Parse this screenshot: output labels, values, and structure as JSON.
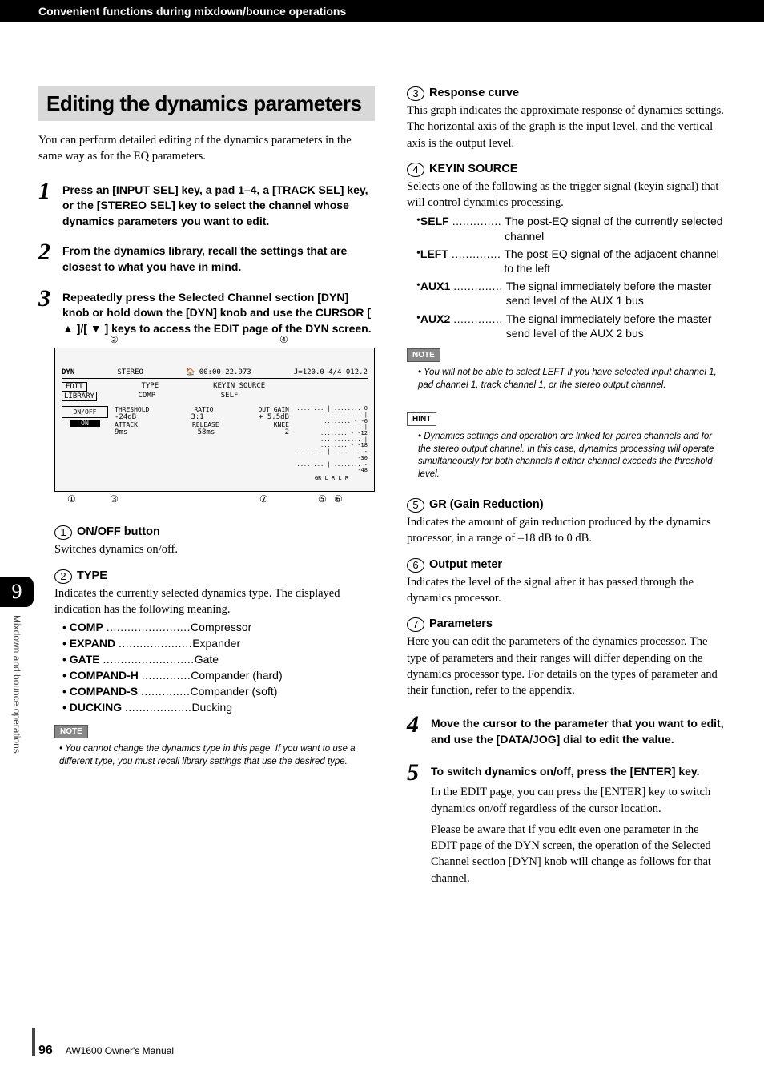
{
  "header": "Convenient functions during mixdown/bounce operations",
  "title": "Editing the dynamics parameters",
  "intro": "You can perform detailed editing of the dynamics parameters in the same way as for the EQ parameters.",
  "steps_left": [
    "Press an [INPUT SEL] key, a pad 1–4, a [TRACK SEL] key, or the [STEREO SEL] key to select the channel whose dynamics parameters you want to edit.",
    "From the dynamics library, recall the settings that are closest to what you have in mind.",
    "Repeatedly press the Selected Channel section [DYN] knob or hold down the [DYN] knob and use the CURSOR [ ▲ ]/[ ▼ ] keys to access the EDIT page of the DYN screen."
  ],
  "screen": {
    "title_bar_left": "DYN",
    "title_bar_mid": "STEREO",
    "title_bar_time": "00:00:22.973",
    "title_bar_right": "J=120.0 4/4 012.2",
    "tabs_left": "EDIT",
    "tabs_left2": "LIBRARY",
    "type_label": "TYPE",
    "type_value": "COMP",
    "keyin_source_label": "KEYIN SOURCE",
    "keyin_source_value": "SELF",
    "onoff": "ON/OFF",
    "on_val": "ON",
    "threshold": "THRESHOLD",
    "threshold_val": "-24dB",
    "ratio": "RATIO",
    "ratio_val": "3:1",
    "outgain": "OUT GAIN",
    "outgain_val": "+ 5.5dB",
    "attack": "ATTACK",
    "attack_val": "9ms",
    "release": "RELEASE",
    "release_val": "58ms",
    "knee": "KNEE",
    "knee_val": "2",
    "meters_label": "GR L R   L R",
    "scale": [
      "0",
      "-6",
      "-12",
      "-18",
      "-30",
      "-48"
    ]
  },
  "item1_label": "ON/OFF button",
  "item1_desc": "Switches dynamics on/off.",
  "item2_label": "TYPE",
  "item2_desc": "Indicates the currently selected dynamics type. The displayed indication has the following meaning.",
  "type_list": [
    {
      "label": "COMP",
      "dots": "........................",
      "desc": "Compressor"
    },
    {
      "label": "EXPAND",
      "dots": ".....................",
      "desc": "Expander"
    },
    {
      "label": "GATE",
      "dots": "..........................",
      "desc": "Gate"
    },
    {
      "label": "COMPAND-H",
      "dots": "..............",
      "desc": "Compander (hard)"
    },
    {
      "label": "COMPAND-S",
      "dots": "..............",
      "desc": "Compander (soft)"
    },
    {
      "label": "DUCKING",
      "dots": "...................",
      "desc": "Ducking"
    }
  ],
  "note_left": "You cannot change the dynamics type in this page. If you want to use a different type, you must recall library settings that use the desired type.",
  "item3_label": "Response curve",
  "item3_desc": "This graph indicates the approximate response of dynamics settings. The horizontal axis of the graph is the input level, and the vertical axis is the output level.",
  "item4_label": "KEYIN SOURCE",
  "item4_desc": "Selects one of the following as the trigger signal (keyin signal) that will control dynamics processing.",
  "keyin_list": [
    {
      "label": "SELF",
      "dots": "..............",
      "desc": "The post-EQ signal of the currently selected channel"
    },
    {
      "label": "LEFT",
      "dots": "..............",
      "desc": "The post-EQ signal of the adjacent channel to the left"
    },
    {
      "label": "AUX1",
      "dots": "..............",
      "desc": "The signal immediately before the master send level of the AUX 1 bus"
    },
    {
      "label": "AUX2",
      "dots": "..............",
      "desc": "The signal immediately before the master send level of the AUX 2 bus"
    }
  ],
  "note_right": "You will not be able to select LEFT if you have selected input channel 1, pad channel 1, track channel 1, or the stereo output channel.",
  "hint_right": "Dynamics settings and operation are linked for paired channels and for the stereo output channel. In this case, dynamics processing will operate simultaneously for both channels if either channel exceeds the threshold level.",
  "item5_label": "GR (Gain Reduction)",
  "item5_desc": "Indicates the amount of gain reduction produced by the dynamics processor, in a range of –18 dB to 0 dB.",
  "item6_label": "Output meter",
  "item6_desc": "Indicates the level of the signal after it has passed through the dynamics processor.",
  "item7_label": "Parameters",
  "item7_desc": "Here you can edit the parameters of the dynamics processor. The type of parameters and their ranges will differ depending on the dynamics processor type. For details on the types of parameter and their function, refer to the appendix.",
  "steps_right": [
    {
      "num": "4",
      "head": "Move the cursor to the parameter that you want to edit, and use the [DATA/JOG] dial to edit the value."
    },
    {
      "num": "5",
      "head": "To switch dynamics on/off, press the [ENTER] key.",
      "p1": "In the EDIT page, you can press the [ENTER] key to switch dynamics on/off regardless of the cursor location.",
      "p2": "Please be aware that if you edit even one parameter in the EDIT page of the DYN screen, the operation of the Selected Channel section [DYN] knob will change as follows for that channel."
    }
  ],
  "side_tab_num": "9",
  "side_tab_text": "Mixdown and bounce operations",
  "page_num": "96",
  "manual_title": "AW1600 Owner's Manual",
  "note_label": "NOTE",
  "hint_label": "HINT"
}
